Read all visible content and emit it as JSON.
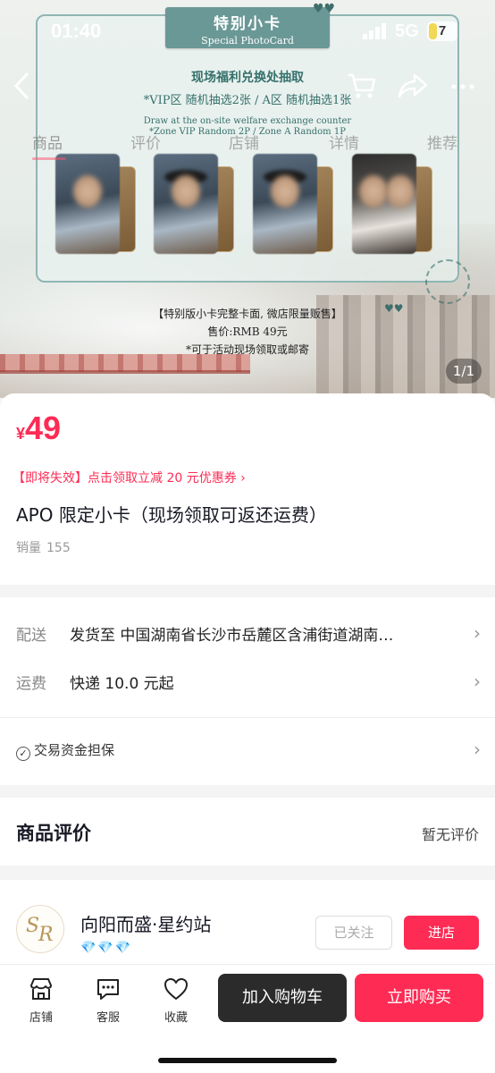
{
  "status_bar": {
    "time": "01:40",
    "network": "5G",
    "battery": "7"
  },
  "nav": {
    "tabs": [
      "商品",
      "评价",
      "店铺",
      "详情",
      "推荐"
    ],
    "active_tab": 0
  },
  "banner": {
    "title_zh": "特别小卡",
    "title_en": "Special PhotoCard",
    "line1": "现场福利兑换处抽取",
    "line2": "*VIP区 随机抽选2张 / A区 随机抽选1张",
    "line3": "Draw at the on-site welfare exchange counter",
    "line4": "*Zone VIP Random 2P / Zone A Random 1P",
    "sale1": "【特别版小卡完整卡面, 微店限量贩售】",
    "sale2": "售价:RMB 49元",
    "sale3": "*可于活动现场领取或邮寄",
    "pager": "1/1"
  },
  "product": {
    "currency": "¥",
    "price": "49",
    "coupon": "【即将失效】点击领取立减 20 元优惠券",
    "title": "APO 限定小卡（现场领取可返还运费）",
    "sales_label": "销量",
    "sales_count": "155"
  },
  "delivery": {
    "label": "配送",
    "value": "发货至  中国湖南省长沙市岳麓区含浦街道湖南…",
    "fee_label": "运费",
    "fee_value": "快递 10.0 元起",
    "guarantee": "交易资金担保"
  },
  "reviews": {
    "heading": "商品评价",
    "status": "暂无评价"
  },
  "shop": {
    "name": "向阳而盛·星约站",
    "gems": "💎💎💎",
    "follow": "已关注",
    "enter": "进店"
  },
  "bottom_bar": {
    "shop": "店铺",
    "service": "客服",
    "favorite": "收藏",
    "add_cart": "加入购物车",
    "buy_now": "立即购买"
  }
}
